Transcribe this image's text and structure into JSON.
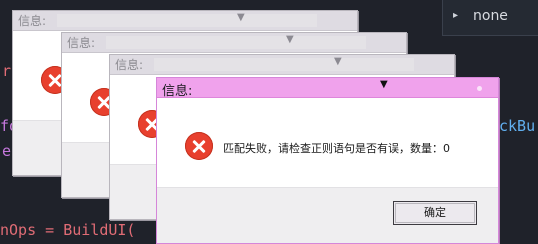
{
  "editor": {
    "code_fragments": [
      {
        "text": "r",
        "color": "#e06c75"
      },
      {
        "text": "fo",
        "color": "#c678dd"
      },
      {
        "text": "e",
        "color": "#c678dd"
      },
      {
        "text": "ckBu",
        "color": "#61afef"
      },
      {
        "text": "nOps = BuildUI(",
        "color": "#e06c75"
      }
    ],
    "suggestion": {
      "label": "none",
      "arrow": "▸"
    }
  },
  "dialogs": [
    {
      "title": "信息:",
      "caret": "▼"
    },
    {
      "title": "信息:",
      "caret": "▼"
    },
    {
      "title": "信息:",
      "caret": "▼"
    },
    {
      "title": "信息:",
      "caret": "▼",
      "message": "匹配失败，请检查正则语句是否有误，数量：0",
      "ok_label": "确定",
      "icon": "error-icon"
    }
  ],
  "colors": {
    "editor_bg": "#1f222a",
    "active_titlebar": "#f0a2ec",
    "inactive_titlebar": "#dedbe2",
    "error_red": "#e8402e"
  }
}
